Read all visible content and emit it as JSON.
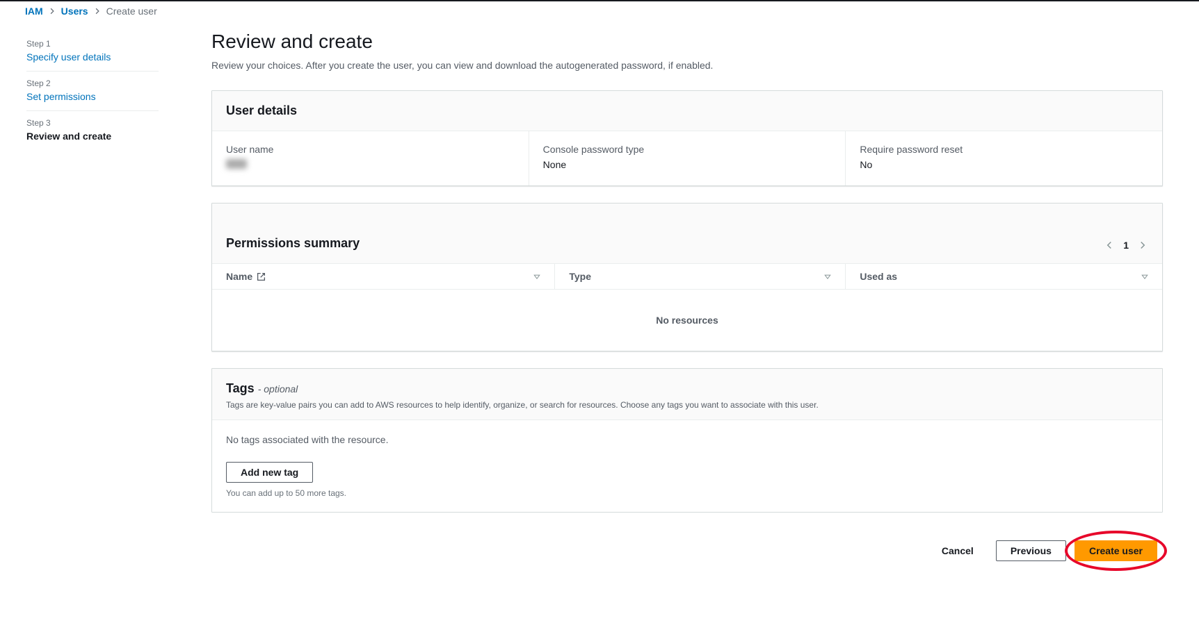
{
  "breadcrumb": {
    "iam": "IAM",
    "users": "Users",
    "current": "Create user"
  },
  "sidebarSteps": {
    "step1_label": "Step 1",
    "step1_title": "Specify user details",
    "step2_label": "Step 2",
    "step2_title": "Set permissions",
    "step3_label": "Step 3",
    "step3_title": "Review and create"
  },
  "page": {
    "title": "Review and create",
    "subtitle": "Review your choices. After you create the user, you can view and download the autogenerated password, if enabled."
  },
  "userDetails": {
    "heading": "User details",
    "username_label": "User name",
    "username_value": "—",
    "password_type_label": "Console password type",
    "password_type_value": "None",
    "require_reset_label": "Require password reset",
    "require_reset_value": "No"
  },
  "permissions": {
    "heading": "Permissions summary",
    "page": "1",
    "col_name": "Name",
    "col_type": "Type",
    "col_used": "Used as",
    "empty": "No resources"
  },
  "tags": {
    "heading": "Tags",
    "optional": "- optional",
    "description": "Tags are key-value pairs you can add to AWS resources to help identify, organize, or search for resources. Choose any tags you want to associate with this user.",
    "empty": "No tags associated with the resource.",
    "add_button": "Add new tag",
    "hint": "You can add up to 50 more tags."
  },
  "footer": {
    "cancel": "Cancel",
    "previous": "Previous",
    "create": "Create user"
  }
}
